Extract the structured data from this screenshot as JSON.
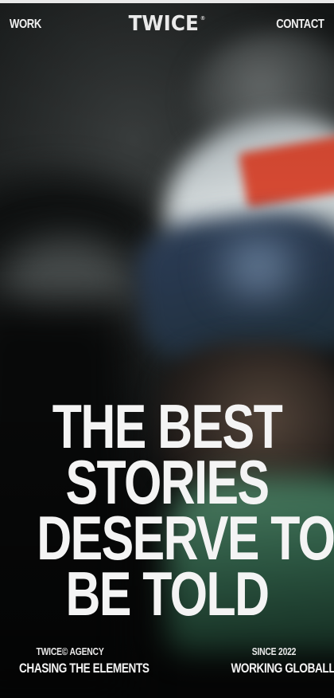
{
  "nav": {
    "work_label": "WORK",
    "logo_text": "TWICE",
    "logo_mark": "®",
    "contact_label": "CONTACT"
  },
  "hero": {
    "headline_lines": [
      "THE BEST",
      "STORIES",
      "DESERVE TO",
      "BE TOLD"
    ]
  },
  "footer": {
    "left_small": "TWICE© AGENCY",
    "left_big": "CHASING THE ELEMENTS",
    "right_small": "SINCE 2022",
    "right_big": "WORKING GLOBALLY"
  },
  "colors": {
    "text": "#f4f4f4",
    "background": "#0b0c0d",
    "accent_red": "#d84a33",
    "accent_green": "#3e7a5d"
  }
}
